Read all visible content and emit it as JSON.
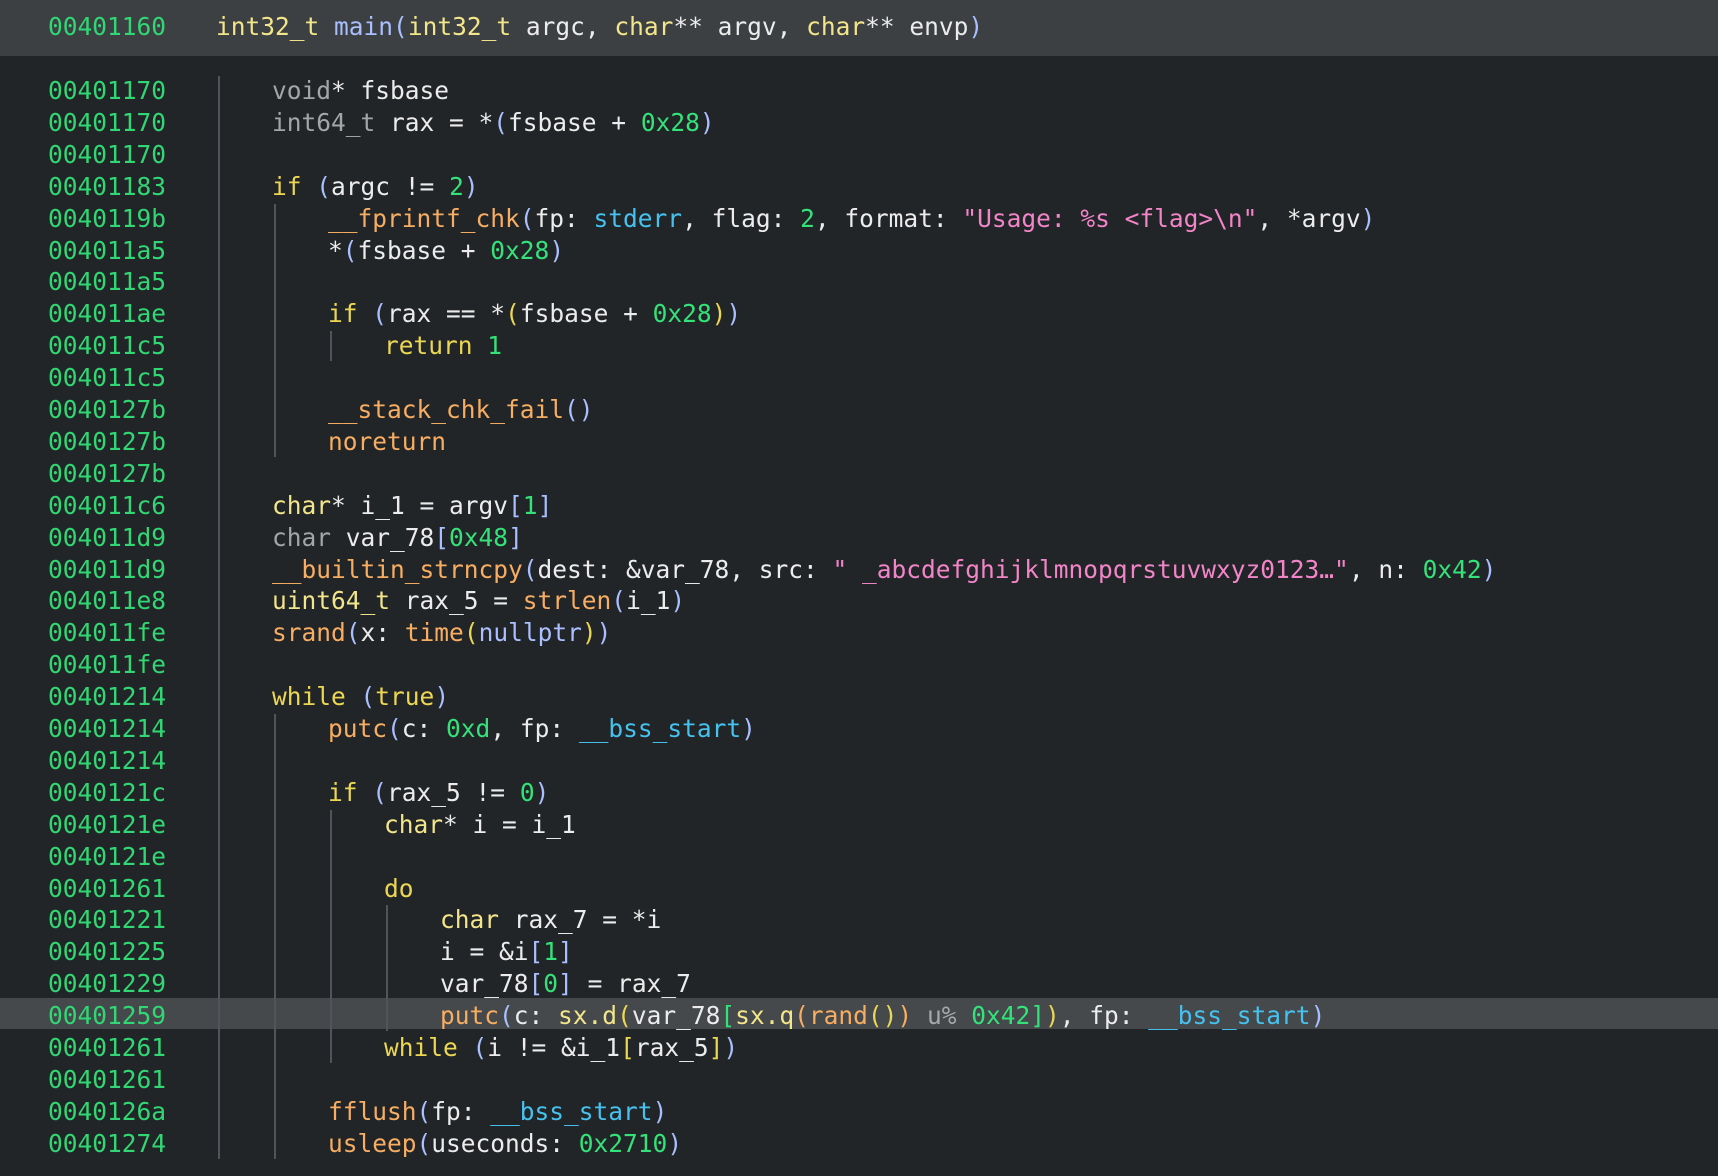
{
  "colors": {
    "background": "#222527",
    "header_background": "#3c4043",
    "highlight_background": "#45494c",
    "address": "#31d774",
    "type": "#f2e58a",
    "function": "#f7ad62",
    "keyword": "#ecd753",
    "number": "#34e27a",
    "string": "#f285c8",
    "global": "#46c2ef"
  },
  "highlighted_line": 29,
  "header": {
    "address": "00401160",
    "tokens": [
      {
        "t": "int32_t",
        "c": "type"
      },
      {
        "t": " ",
        "c": "id"
      },
      {
        "t": "main",
        "c": "fnh"
      },
      {
        "t": "(",
        "c": "p1"
      },
      {
        "t": "int32_t",
        "c": "type"
      },
      {
        "t": " argc, ",
        "c": "id"
      },
      {
        "t": "char",
        "c": "type"
      },
      {
        "t": "** argv, ",
        "c": "id"
      },
      {
        "t": "char",
        "c": "type"
      },
      {
        "t": "** envp",
        "c": "id"
      },
      {
        "t": ")",
        "c": "p1"
      }
    ]
  },
  "lines": [
    {
      "address": "00401170",
      "indent": 1,
      "tokens": [
        {
          "t": "void",
          "c": "vt"
        },
        {
          "t": "* fsbase",
          "c": "id"
        }
      ]
    },
    {
      "address": "00401170",
      "indent": 1,
      "tokens": [
        {
          "t": "int64_t",
          "c": "vt"
        },
        {
          "t": " rax = *",
          "c": "id"
        },
        {
          "t": "(",
          "c": "p1"
        },
        {
          "t": "fsbase + ",
          "c": "id"
        },
        {
          "t": "0x28",
          "c": "num"
        },
        {
          "t": ")",
          "c": "p1"
        }
      ]
    },
    {
      "address": "00401170",
      "indent": 1,
      "tokens": []
    },
    {
      "address": "00401183",
      "indent": 1,
      "tokens": [
        {
          "t": "if",
          "c": "kw"
        },
        {
          "t": " ",
          "c": "id"
        },
        {
          "t": "(",
          "c": "p1"
        },
        {
          "t": "argc != ",
          "c": "id"
        },
        {
          "t": "2",
          "c": "num"
        },
        {
          "t": ")",
          "c": "p1"
        }
      ]
    },
    {
      "address": "0040119b",
      "indent": 2,
      "tokens": [
        {
          "t": "__fprintf_chk",
          "c": "fn"
        },
        {
          "t": "(",
          "c": "p1"
        },
        {
          "t": "fp: ",
          "c": "id"
        },
        {
          "t": "stderr",
          "c": "glob"
        },
        {
          "t": ", flag: ",
          "c": "id"
        },
        {
          "t": "2",
          "c": "num"
        },
        {
          "t": ", format: ",
          "c": "id"
        },
        {
          "t": "\"Usage: %s <flag>\\n\"",
          "c": "str"
        },
        {
          "t": ", *argv",
          "c": "id"
        },
        {
          "t": ")",
          "c": "p1"
        }
      ]
    },
    {
      "address": "004011a5",
      "indent": 2,
      "tokens": [
        {
          "t": "*",
          "c": "id"
        },
        {
          "t": "(",
          "c": "p1"
        },
        {
          "t": "fsbase + ",
          "c": "id"
        },
        {
          "t": "0x28",
          "c": "num"
        },
        {
          "t": ")",
          "c": "p1"
        }
      ]
    },
    {
      "address": "004011a5",
      "indent": 2,
      "tokens": []
    },
    {
      "address": "004011ae",
      "indent": 2,
      "tokens": [
        {
          "t": "if",
          "c": "kw"
        },
        {
          "t": " ",
          "c": "id"
        },
        {
          "t": "(",
          "c": "p1"
        },
        {
          "t": "rax == *",
          "c": "id"
        },
        {
          "t": "(",
          "c": "p2"
        },
        {
          "t": "fsbase + ",
          "c": "id"
        },
        {
          "t": "0x28",
          "c": "num"
        },
        {
          "t": ")",
          "c": "p2"
        },
        {
          "t": ")",
          "c": "p1"
        }
      ]
    },
    {
      "address": "004011c5",
      "indent": 3,
      "tokens": [
        {
          "t": "return",
          "c": "kw"
        },
        {
          "t": " ",
          "c": "id"
        },
        {
          "t": "1",
          "c": "num"
        }
      ]
    },
    {
      "address": "004011c5",
      "indent": 2,
      "tokens": []
    },
    {
      "address": "0040127b",
      "indent": 2,
      "tokens": [
        {
          "t": "__stack_chk_fail",
          "c": "fn"
        },
        {
          "t": "()",
          "c": "p1"
        }
      ]
    },
    {
      "address": "0040127b",
      "indent": 2,
      "tokens": [
        {
          "t": "noreturn",
          "c": "fn"
        }
      ]
    },
    {
      "address": "0040127b",
      "indent": 1,
      "tokens": []
    },
    {
      "address": "004011c6",
      "indent": 1,
      "tokens": [
        {
          "t": "char",
          "c": "type"
        },
        {
          "t": "* i_1 = argv",
          "c": "id"
        },
        {
          "t": "[",
          "c": "p1"
        },
        {
          "t": "1",
          "c": "num"
        },
        {
          "t": "]",
          "c": "p1"
        }
      ]
    },
    {
      "address": "004011d9",
      "indent": 1,
      "tokens": [
        {
          "t": "char",
          "c": "vt"
        },
        {
          "t": " var_78",
          "c": "id"
        },
        {
          "t": "[",
          "c": "p1"
        },
        {
          "t": "0x48",
          "c": "num"
        },
        {
          "t": "]",
          "c": "p1"
        }
      ]
    },
    {
      "address": "004011d9",
      "indent": 1,
      "tokens": [
        {
          "t": "__builtin_strncpy",
          "c": "fn"
        },
        {
          "t": "(",
          "c": "p1"
        },
        {
          "t": "dest: &var_78, src: ",
          "c": "id"
        },
        {
          "t": "\" _abcdefghijklmnopqrstuvwxyz0123…\"",
          "c": "str"
        },
        {
          "t": ", n: ",
          "c": "id"
        },
        {
          "t": "0x42",
          "c": "num"
        },
        {
          "t": ")",
          "c": "p1"
        }
      ]
    },
    {
      "address": "004011e8",
      "indent": 1,
      "tokens": [
        {
          "t": "uint64_t",
          "c": "type"
        },
        {
          "t": " rax_5 = ",
          "c": "id"
        },
        {
          "t": "strlen",
          "c": "fn"
        },
        {
          "t": "(",
          "c": "p1"
        },
        {
          "t": "i_1",
          "c": "id"
        },
        {
          "t": ")",
          "c": "p1"
        }
      ]
    },
    {
      "address": "004011fe",
      "indent": 1,
      "tokens": [
        {
          "t": "srand",
          "c": "fn"
        },
        {
          "t": "(",
          "c": "p1"
        },
        {
          "t": "x: ",
          "c": "id"
        },
        {
          "t": "time",
          "c": "fn"
        },
        {
          "t": "(",
          "c": "p2"
        },
        {
          "t": "nullptr",
          "c": "fnh"
        },
        {
          "t": ")",
          "c": "p2"
        },
        {
          "t": ")",
          "c": "p1"
        }
      ]
    },
    {
      "address": "004011fe",
      "indent": 1,
      "tokens": []
    },
    {
      "address": "00401214",
      "indent": 1,
      "tokens": [
        {
          "t": "while",
          "c": "kw"
        },
        {
          "t": " ",
          "c": "id"
        },
        {
          "t": "(",
          "c": "p1"
        },
        {
          "t": "true",
          "c": "kw"
        },
        {
          "t": ")",
          "c": "p1"
        }
      ]
    },
    {
      "address": "00401214",
      "indent": 2,
      "tokens": [
        {
          "t": "putc",
          "c": "fn"
        },
        {
          "t": "(",
          "c": "p1"
        },
        {
          "t": "c: ",
          "c": "id"
        },
        {
          "t": "0xd",
          "c": "num"
        },
        {
          "t": ", fp: ",
          "c": "id"
        },
        {
          "t": "__bss_start",
          "c": "glob"
        },
        {
          "t": ")",
          "c": "p1"
        }
      ]
    },
    {
      "address": "00401214",
      "indent": 2,
      "tokens": []
    },
    {
      "address": "0040121c",
      "indent": 2,
      "tokens": [
        {
          "t": "if",
          "c": "kw"
        },
        {
          "t": " ",
          "c": "id"
        },
        {
          "t": "(",
          "c": "p1"
        },
        {
          "t": "rax_5 != ",
          "c": "id"
        },
        {
          "t": "0",
          "c": "num"
        },
        {
          "t": ")",
          "c": "p1"
        }
      ]
    },
    {
      "address": "0040121e",
      "indent": 3,
      "tokens": [
        {
          "t": "char",
          "c": "type"
        },
        {
          "t": "* i = i_1",
          "c": "id"
        }
      ]
    },
    {
      "address": "0040121e",
      "indent": 3,
      "tokens": []
    },
    {
      "address": "00401261",
      "indent": 3,
      "tokens": [
        {
          "t": "do",
          "c": "kw"
        }
      ]
    },
    {
      "address": "00401221",
      "indent": 4,
      "tokens": [
        {
          "t": "char",
          "c": "type"
        },
        {
          "t": " rax_7 = *i",
          "c": "id"
        }
      ]
    },
    {
      "address": "00401225",
      "indent": 4,
      "tokens": [
        {
          "t": "i = &i",
          "c": "id"
        },
        {
          "t": "[",
          "c": "p1"
        },
        {
          "t": "1",
          "c": "num"
        },
        {
          "t": "]",
          "c": "p1"
        }
      ]
    },
    {
      "address": "00401229",
      "indent": 4,
      "tokens": [
        {
          "t": "var_78",
          "c": "id"
        },
        {
          "t": "[",
          "c": "p1"
        },
        {
          "t": "0",
          "c": "num"
        },
        {
          "t": "]",
          "c": "p1"
        },
        {
          "t": " = rax_7",
          "c": "id"
        }
      ]
    },
    {
      "address": "00401259",
      "indent": 4,
      "tokens": [
        {
          "t": "putc",
          "c": "fn"
        },
        {
          "t": "(",
          "c": "p1"
        },
        {
          "t": "c: ",
          "c": "id"
        },
        {
          "t": "sx.d",
          "c": "type"
        },
        {
          "t": "(",
          "c": "p2"
        },
        {
          "t": "var_78",
          "c": "id"
        },
        {
          "t": "[",
          "c": "p3"
        },
        {
          "t": "sx.q",
          "c": "type"
        },
        {
          "t": "(",
          "c": "fn"
        },
        {
          "t": "rand",
          "c": "fn"
        },
        {
          "t": "()",
          "c": "p2"
        },
        {
          "t": ")",
          "c": "fn"
        },
        {
          "t": " ",
          "c": "id"
        },
        {
          "t": "u%",
          "c": "gray"
        },
        {
          "t": " ",
          "c": "id"
        },
        {
          "t": "0x42",
          "c": "num"
        },
        {
          "t": "]",
          "c": "p3"
        },
        {
          "t": ")",
          "c": "p2"
        },
        {
          "t": ", fp: ",
          "c": "id"
        },
        {
          "t": "__bss_start",
          "c": "glob"
        },
        {
          "t": ")",
          "c": "p1"
        }
      ]
    },
    {
      "address": "00401261",
      "indent": 3,
      "tokens": [
        {
          "t": "while",
          "c": "kw"
        },
        {
          "t": " ",
          "c": "id"
        },
        {
          "t": "(",
          "c": "p1"
        },
        {
          "t": "i != &i_1",
          "c": "id"
        },
        {
          "t": "[",
          "c": "p2"
        },
        {
          "t": "rax_5",
          "c": "id"
        },
        {
          "t": "]",
          "c": "p2"
        },
        {
          "t": ")",
          "c": "p1"
        }
      ]
    },
    {
      "address": "00401261",
      "indent": 2,
      "tokens": []
    },
    {
      "address": "0040126a",
      "indent": 2,
      "tokens": [
        {
          "t": "fflush",
          "c": "fn"
        },
        {
          "t": "(",
          "c": "p1"
        },
        {
          "t": "fp: ",
          "c": "id"
        },
        {
          "t": "__bss_start",
          "c": "glob"
        },
        {
          "t": ")",
          "c": "p1"
        }
      ]
    },
    {
      "address": "00401274",
      "indent": 2,
      "tokens": [
        {
          "t": "usleep",
          "c": "fn"
        },
        {
          "t": "(",
          "c": "p1"
        },
        {
          "t": "useconds: ",
          "c": "id"
        },
        {
          "t": "0x2710",
          "c": "num"
        },
        {
          "t": ")",
          "c": "p1"
        }
      ]
    }
  ]
}
